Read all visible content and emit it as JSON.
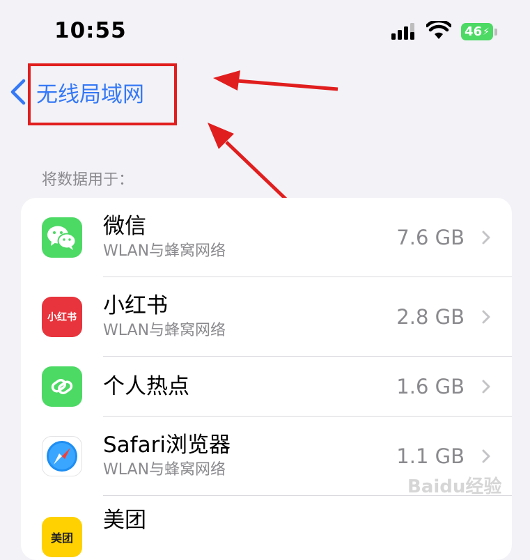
{
  "status_bar": {
    "time": "10:55",
    "battery": "46"
  },
  "nav": {
    "back_label": "无线局域网"
  },
  "section": {
    "header": "将数据用于："
  },
  "apps": [
    {
      "name": "微信",
      "subtitle": "WLAN与蜂窝网络",
      "usage": "7.6 GB",
      "icon": "wechat-icon",
      "icon_text": ""
    },
    {
      "name": "小红书",
      "subtitle": "WLAN与蜂窝网络",
      "usage": "2.8 GB",
      "icon": "xiaohongshu-icon",
      "icon_text": "小红书"
    },
    {
      "name": "个人热点",
      "subtitle": "",
      "usage": "1.6 GB",
      "icon": "hotspot-icon",
      "icon_text": ""
    },
    {
      "name": "Safari浏览器",
      "subtitle": "WLAN与蜂窝网络",
      "usage": "1.1 GB",
      "icon": "safari-icon",
      "icon_text": ""
    },
    {
      "name": "美团",
      "subtitle": "",
      "usage": "",
      "icon": "meituan-icon",
      "icon_text": "美团"
    }
  ],
  "watermark": "Baidu经验",
  "colors": {
    "accent": "#3478f6",
    "highlight": "#e11e1e",
    "wechat": "#4cd964",
    "xiaohongshu": "#e8343c",
    "meituan": "#ffd100"
  }
}
